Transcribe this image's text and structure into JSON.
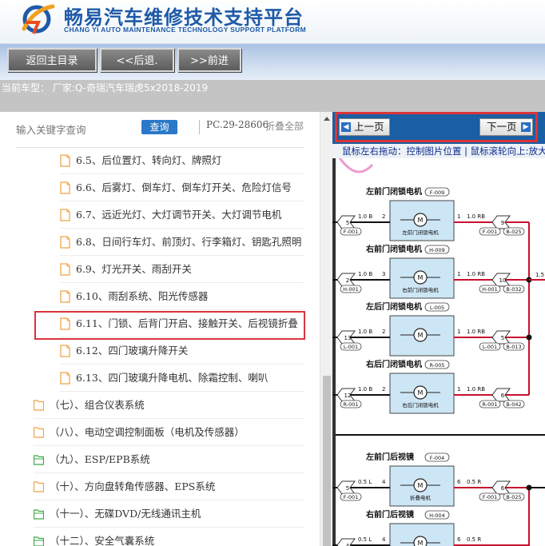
{
  "header": {
    "title_cn": "畅易汽车维修技术支持平台",
    "title_en": "CHANG YI AUTO MAINTENANCE TECHNOLOGY SUPPORT PLATFORM"
  },
  "toolbar": {
    "home_label": "返回主目录",
    "back_label": "<<后退.",
    "forward_label": ">>前进"
  },
  "vehicle_info": "当前车型： 厂家:Q-奇瑞汽车瑞虎5x2018-2019",
  "search": {
    "placeholder": "输入关键字查询",
    "button_label": "查询",
    "pc_code": "PC.29-28606",
    "collapse_label": "折叠全部"
  },
  "tree": {
    "items": [
      {
        "label": "6.5、后位置灯、转向灯、牌照灯",
        "icon": "file-icon"
      },
      {
        "label": "6.6、后雾灯、倒车灯、倒车灯开关、危险灯信号",
        "icon": "file-icon"
      },
      {
        "label": "6.7、远近光灯、大灯调节开关、大灯调节电机",
        "icon": "file-icon"
      },
      {
        "label": "6.8、日间行车灯、前顶灯、行李箱灯、钥匙孔照明",
        "icon": "file-icon"
      },
      {
        "label": "6.9、灯光开关、雨刮开关",
        "icon": "file-icon"
      },
      {
        "label": "6.10、雨刮系统、阳光传感器",
        "icon": "file-icon"
      },
      {
        "label": "6.11、门锁、后背门开启、接触开关、后视镜折叠",
        "icon": "file-icon"
      },
      {
        "label": "6.12、四门玻璃升降开关",
        "icon": "file-icon"
      },
      {
        "label": "6.13、四门玻璃升降电机、除霜控制、喇叭",
        "icon": "file-icon"
      },
      {
        "label": "（七）、组合仪表系统",
        "icon": "folder-icon"
      },
      {
        "label": "（八）、电动空调控制面板（电机及传感器）",
        "icon": "folder-icon"
      },
      {
        "label": "（九）、ESP/EPB系统",
        "icon": "folder-open-icon"
      },
      {
        "label": "（十）、方向盘转角传感器、EPS系统",
        "icon": "folder-icon"
      },
      {
        "label": "（十一）、无碟DVD/无线通讯主机",
        "icon": "folder-open-icon"
      },
      {
        "label": "（十二）、安全气囊系统",
        "icon": "folder-open-icon"
      }
    ]
  },
  "viewer": {
    "prev_label": "上一页",
    "next_label": "下一页",
    "hint": "鼠标左右拖动：控制图片位置 | 鼠标滚轮向上:放大",
    "diagram": {
      "motors": [
        {
          "title": "左前门闭锁电机",
          "code": "F-009",
          "inner": "左前门闭锁电机",
          "wire_in": "1.0 B",
          "pin_in": "2",
          "pin_out": "1",
          "wire_out": "1.0 RB",
          "conn_left": "F-001",
          "conn_right_a": "F-001",
          "conn_right_b": "B-025",
          "n_left": "5",
          "n_right": "9"
        },
        {
          "title": "右前门闭锁电机",
          "code": "H-009",
          "inner": "右前门闭锁电机",
          "wire_in": "1.0 B",
          "pin_in": "3",
          "pin_out": "1",
          "wire_out": "1.0 RB",
          "conn_left": "H-001",
          "conn_right_a": "H-001",
          "conn_right_b": "B-032",
          "n_left": "2",
          "n_right": "10"
        },
        {
          "title": "左后门闭锁电机",
          "code": "L-005",
          "inner": "",
          "wire_in": "1.0 B",
          "pin_in": "2",
          "pin_out": "1",
          "wire_out": "1.0 RB",
          "conn_left": "L-001",
          "conn_right_a": "L-001",
          "conn_right_b": "B-013",
          "n_left": "13",
          "n_right": "5"
        },
        {
          "title": "右后门闭锁电机",
          "code": "R-005",
          "inner": "右后门闭锁电机",
          "wire_in": "1.0 B",
          "pin_in": "2",
          "pin_out": "1",
          "wire_out": "1.0 RB",
          "conn_left": "R-001",
          "conn_right_a": "R-001",
          "conn_right_b": "B-042",
          "n_left": "12",
          "n_right": "6"
        },
        {
          "title": "左前门后视镜",
          "code": "F-004",
          "inner": "折叠电机",
          "wire_in": "0.5 L",
          "pin_in": "4",
          "pin_out": "6",
          "wire_out": "0.5 R",
          "conn_left": "F-001",
          "conn_right_a": "F-001",
          "conn_right_b": "B-025",
          "n_left": "5",
          "n_right": "6"
        },
        {
          "title": "右前门后视镜",
          "code": "H-004",
          "inner": "",
          "wire_in": "0.5 L",
          "pin_in": "4",
          "pin_out": "6",
          "wire_out": "0.5 R",
          "conn_left": "",
          "conn_right_a": "",
          "conn_right_b": "",
          "n_left": "4",
          "n_right": ""
        }
      ],
      "right_wire_label": "1.5"
    }
  },
  "colors": {
    "brand_blue": "#1e5aa8",
    "nav_blue": "#1a5ea3",
    "highlight_red": "#d9343a",
    "wire_red": "#c8102e",
    "motor_fill": "#cde6f5"
  }
}
